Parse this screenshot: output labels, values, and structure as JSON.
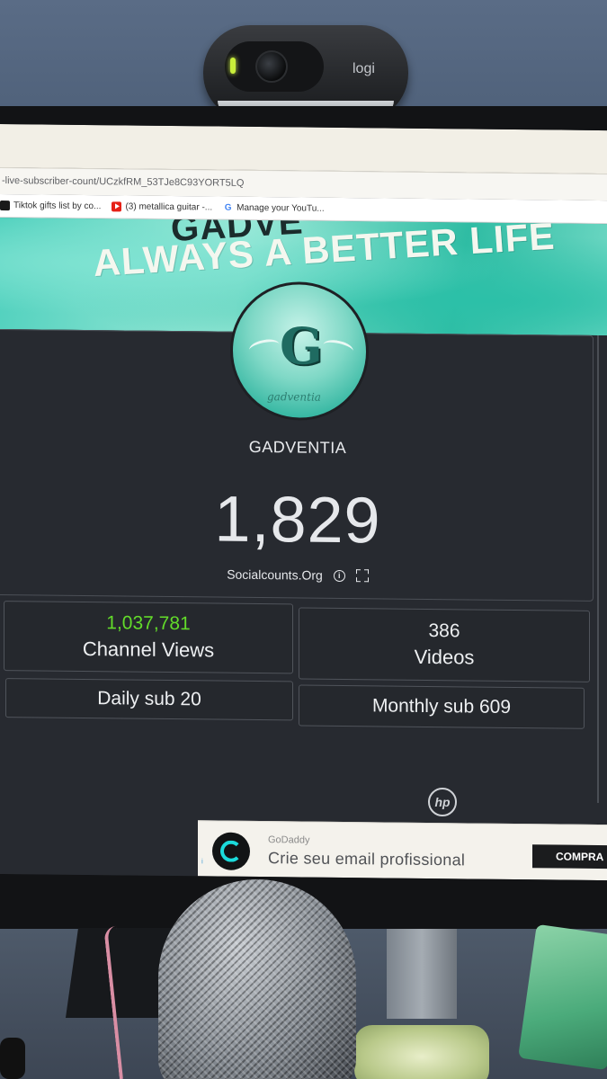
{
  "webcam": {
    "brand": "logi"
  },
  "browser": {
    "url": "-live-subscriber-count/UCzkfRM_53TJe8C93YORT5LQ",
    "bookmarks": [
      {
        "label": "Tiktok gifts list by co...",
        "icon": "tiktok-icon"
      },
      {
        "label": "(3) metallica guitar -...",
        "icon": "youtube-icon"
      },
      {
        "label": "Manage your YouTu...",
        "icon": "google-icon"
      }
    ]
  },
  "banner": {
    "top_word": "GADVE",
    "slogan": "ALWAYS A BETTER LIFE"
  },
  "avatar": {
    "letter": "G",
    "script": "gadventia"
  },
  "channel": {
    "name": "GADVENTIA",
    "subscribers": "1,829",
    "source": "Socialcounts.Org",
    "info_icon": "i"
  },
  "stats": {
    "views_value": "1,037,781",
    "views_label": "Channel Views",
    "videos_value": "386",
    "videos_label": "Videos",
    "daily": "Daily sub 20",
    "monthly": "Monthly sub 609"
  },
  "ad": {
    "brand": "GoDaddy",
    "headline": "Crie seu email profissional",
    "cta": "COMPRA",
    "choices_icon": "i",
    "colors": {
      "logo_ring": "#1bdbdb"
    }
  },
  "monitor": {
    "brand": "hp"
  },
  "colors": {
    "views_value": "#63dc2a",
    "panel_bg": "#272a30"
  }
}
